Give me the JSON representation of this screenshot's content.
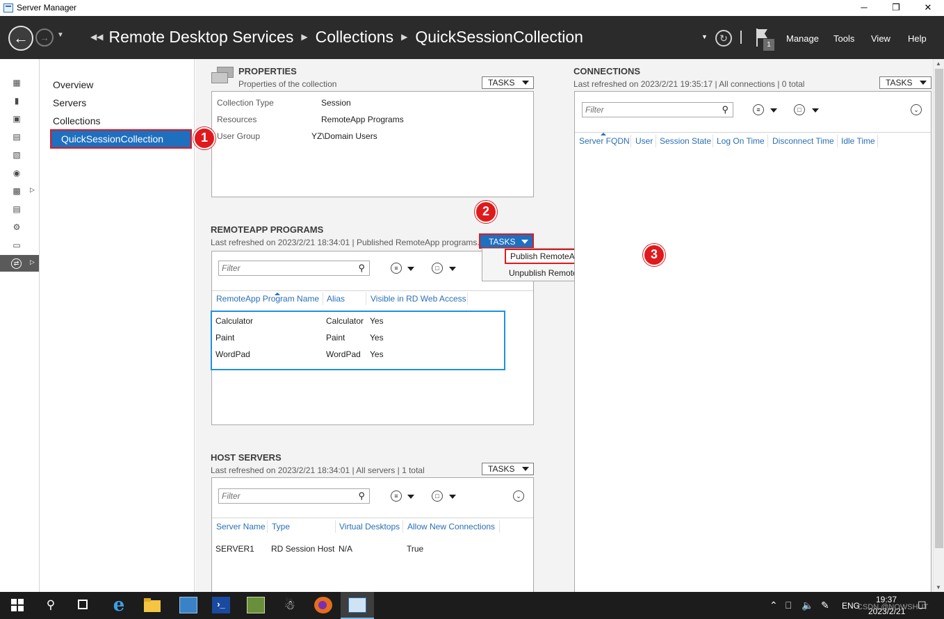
{
  "window": {
    "title": "Server Manager",
    "controls": {
      "minimize": "─",
      "maximize": "❐",
      "close": "✕"
    }
  },
  "header": {
    "breadcrumb": [
      "Remote Desktop Services",
      "Collections",
      "QuickSessionCollection"
    ],
    "notification_count": "1",
    "menu": {
      "manage": "Manage",
      "tools": "Tools",
      "view": "View",
      "help": "Help"
    }
  },
  "rail": {
    "icons": [
      "dashboard-icon",
      "local-server-icon",
      "all-servers-icon",
      "file-storage-icon",
      "iis-icon",
      "adcs-icon",
      "file-services-icon",
      "print-services-icon",
      "remote-access-icon",
      "server-role-icon",
      "remote-desktop-icon"
    ]
  },
  "nav": {
    "items": [
      "Overview",
      "Servers",
      "Collections"
    ],
    "selected": "QuickSessionCollection"
  },
  "properties": {
    "title": "PROPERTIES",
    "subtitle": "Properties of the collection",
    "tasks": "TASKS",
    "rows": [
      {
        "label": "Collection Type",
        "value": "Session"
      },
      {
        "label": "Resources",
        "value": "RemoteApp Programs"
      },
      {
        "label": "User Group",
        "value": "YZ\\Domain Users"
      }
    ]
  },
  "remoteapp": {
    "title": "REMOTEAPP PROGRAMS",
    "subtitle": "Last refreshed on 2023/2/21 18:34:01 | Published RemoteApp programs...",
    "tasks": "TASKS",
    "filter_placeholder": "Filter",
    "columns": [
      "RemoteApp Program Name",
      "Alias",
      "Visible in RD Web Access"
    ],
    "rows": [
      [
        "Calculator",
        "Calculator",
        "Yes"
      ],
      [
        "Paint",
        "Paint",
        "Yes"
      ],
      [
        "WordPad",
        "WordPad",
        "Yes"
      ]
    ],
    "menu": [
      "Publish RemoteApp Programs",
      "Unpublish RemoteApp Programs"
    ]
  },
  "host_servers": {
    "title": "HOST SERVERS",
    "subtitle": "Last refreshed on 2023/2/21 18:34:01 | All servers  | 1 total",
    "tasks": "TASKS",
    "filter_placeholder": "Filter",
    "columns": [
      "Server Name",
      "Type",
      "Virtual Desktops",
      "Allow New Connections"
    ],
    "rows": [
      [
        "SERVER1",
        "RD Session Host",
        "N/A",
        "True"
      ]
    ]
  },
  "connections": {
    "title": "CONNECTIONS",
    "subtitle": "Last refreshed on 2023/2/21 19:35:17 | All connections  | 0 total",
    "tasks": "TASKS",
    "filter_placeholder": "Filter",
    "columns": [
      "Server FQDN",
      "User",
      "Session State",
      "Log On Time",
      "Disconnect Time",
      "Idle Time"
    ]
  },
  "annotations": {
    "step1": "1",
    "step2": "2",
    "step3": "3"
  },
  "taskbar": {
    "language": "ENG",
    "time": "19:37",
    "date": "2023/2/21",
    "watermark": "CSDN @NOWSHUT"
  },
  "colors": {
    "accent": "#1f6fbf",
    "annotation_red": "#e0191d",
    "highlight_blue": "#1e90e0",
    "header_bg": "#2b2b2b"
  }
}
